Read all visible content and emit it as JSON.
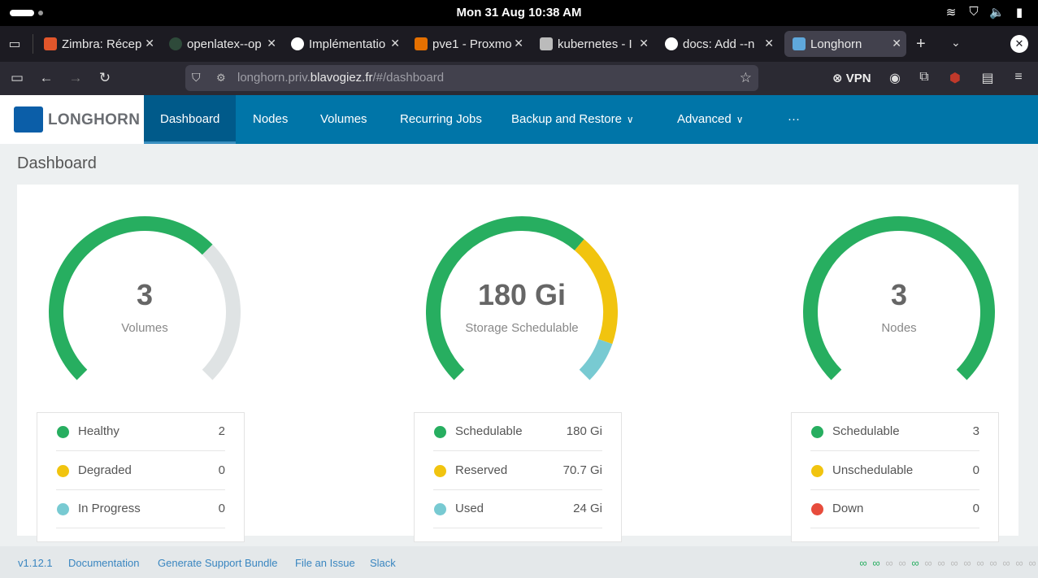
{
  "os": {
    "clock": "Mon 31 Aug  10:38 AM"
  },
  "tabs": [
    {
      "label": "Zimbra: Récep",
      "color": "#e2562b"
    },
    {
      "label": "openlatex--op",
      "color": "#2b2a33"
    },
    {
      "label": "Implémentatio",
      "color": "#ffffff"
    },
    {
      "label": "pve1 - Proxmo",
      "color": "#e57000"
    },
    {
      "label": "kubernetes - I",
      "color": "#ffffff"
    },
    {
      "label": "docs: Add --n",
      "color": "#ffffff"
    },
    {
      "label": "Longhorn",
      "color": "#5fa8dc"
    }
  ],
  "browser": {
    "url_host": "longhorn.priv.",
    "url_domain": "blavogiez.fr",
    "url_path": "/#/dashboard",
    "vpn_label": "VPN"
  },
  "app": {
    "logo_text": "LONGHORN",
    "menu": [
      "Dashboard",
      "Nodes",
      "Volumes",
      "Recurring Jobs",
      "Backup and Restore",
      "Advanced",
      "···"
    ],
    "page_title": "Dashboard"
  },
  "gauges": [
    {
      "value": "3",
      "label": "Volumes",
      "segments": [
        {
          "color": "#27ae60",
          "fraction": 0.667
        },
        {
          "color": "#dfe3e4",
          "fraction": 0.333
        }
      ],
      "legend": [
        {
          "name": "Healthy",
          "value": "2",
          "color": "#27ae60"
        },
        {
          "name": "Degraded",
          "value": "0",
          "color": "#f1c40f"
        },
        {
          "name": "In Progress",
          "value": "0",
          "color": "#78cad2"
        }
      ]
    },
    {
      "value": "180 Gi",
      "label": "Storage Schedulable",
      "segments": [
        {
          "color": "#27ae60",
          "fraction": 0.65
        },
        {
          "color": "#f1c40f",
          "fraction": 0.255
        },
        {
          "color": "#78cad2",
          "fraction": 0.095
        }
      ],
      "legend": [
        {
          "name": "Schedulable",
          "value": "180 Gi",
          "color": "#27ae60"
        },
        {
          "name": "Reserved",
          "value": "70.7 Gi",
          "color": "#f1c40f"
        },
        {
          "name": "Used",
          "value": "24 Gi",
          "color": "#78cad2"
        }
      ]
    },
    {
      "value": "3",
      "label": "Nodes",
      "segments": [
        {
          "color": "#27ae60",
          "fraction": 1.0
        }
      ],
      "legend": [
        {
          "name": "Schedulable",
          "value": "3",
          "color": "#27ae60"
        },
        {
          "name": "Unschedulable",
          "value": "0",
          "color": "#f1c40f"
        },
        {
          "name": "Down",
          "value": "0",
          "color": "#e74c3c"
        }
      ]
    }
  ],
  "footer": {
    "version": "v1.12.1",
    "documentation": "Documentation",
    "support": "Generate Support Bundle",
    "issue": "File an Issue",
    "slack": "Slack",
    "connection_states": [
      true,
      true,
      false,
      false,
      true,
      false,
      false,
      false,
      false,
      false,
      false,
      false,
      false,
      false
    ]
  }
}
